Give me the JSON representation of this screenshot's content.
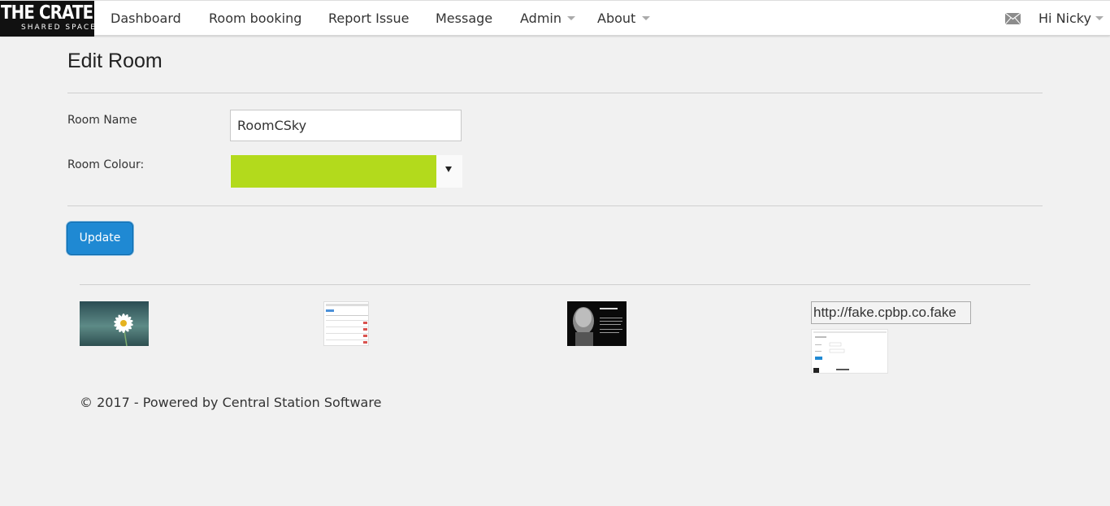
{
  "brand": {
    "line1": "THE CRATE",
    "line2": "SHARED SPACE"
  },
  "nav": {
    "items": [
      {
        "label": "Dashboard"
      },
      {
        "label": "Room booking"
      },
      {
        "label": "Report Issue"
      },
      {
        "label": "Message"
      },
      {
        "label": "Admin"
      },
      {
        "label": "About"
      }
    ],
    "user_greeting": "Hi Nicky"
  },
  "page": {
    "title": "Edit Room"
  },
  "form": {
    "room_name_label": "Room Name",
    "room_name_value": "RoomCSky",
    "room_colour_label": "Room Colour:",
    "room_colour_value": "#b3da1c",
    "update_label": "Update"
  },
  "thumbnails": [
    {
      "name": "daisy-image"
    },
    {
      "name": "table-screenshot-image"
    },
    {
      "name": "portrait-quote-image"
    },
    {
      "name": "broken-image",
      "alt": "http://fake.cpbp.co.fake"
    },
    {
      "name": "form-screenshot-image"
    }
  ],
  "footer": {
    "text": "© 2017 - Powered by Central Station Software"
  },
  "colors": {
    "primary_button": "#1f89d3",
    "background": "#f1f1f1",
    "navbar": "#ffffff"
  }
}
